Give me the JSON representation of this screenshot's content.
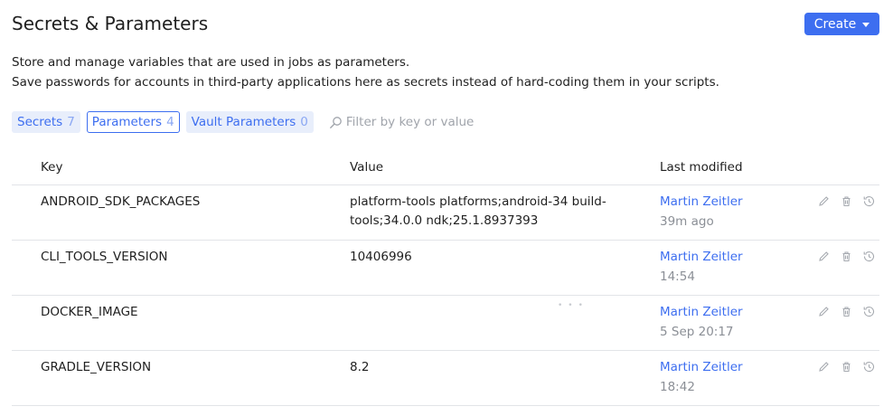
{
  "header": {
    "title": "Secrets & Parameters",
    "create_label": "Create"
  },
  "description": {
    "line1": "Store and manage variables that are used in jobs as parameters.",
    "line2": "Save passwords for accounts in third-party applications here as secrets instead of hard-coding them in your scripts."
  },
  "tabs": [
    {
      "label": "Secrets",
      "count": "7",
      "active": false
    },
    {
      "label": "Parameters",
      "count": "4",
      "active": true
    },
    {
      "label": "Vault Parameters",
      "count": "0",
      "active": false
    }
  ],
  "filter": {
    "placeholder": "Filter by key or value"
  },
  "table": {
    "headers": {
      "key": "Key",
      "value": "Value",
      "modified": "Last modified"
    },
    "rows": [
      {
        "key": "ANDROID_SDK_PACKAGES",
        "value_line1": "platform-tools platforms;android-34 build-",
        "value_line2": "tools;34.0.0 ndk;25.1.8937393",
        "user": "Martin Zeitler",
        "time": "39m ago"
      },
      {
        "key": "CLI_TOOLS_VERSION",
        "value_line1": "10406996",
        "value_line2": "",
        "user": "Martin Zeitler",
        "time": "14:54"
      },
      {
        "key": "DOCKER_IMAGE",
        "value_line1": "",
        "value_line2": "",
        "user": "Martin Zeitler",
        "time": "5 Sep 20:17"
      },
      {
        "key": "GRADLE_VERSION",
        "value_line1": "8.2",
        "value_line2": "",
        "user": "Martin Zeitler",
        "time": "18:42"
      }
    ]
  },
  "icons": {
    "edit": "pencil-icon",
    "delete": "trash-icon",
    "history": "history-icon",
    "filter": "search-icon",
    "create_menu": "chevron-down-icon"
  },
  "colors": {
    "accent": "#3d6ef0",
    "tab_bg": "#e8eefb",
    "muted": "#8b8f96",
    "divider": "#e2e4e8"
  }
}
